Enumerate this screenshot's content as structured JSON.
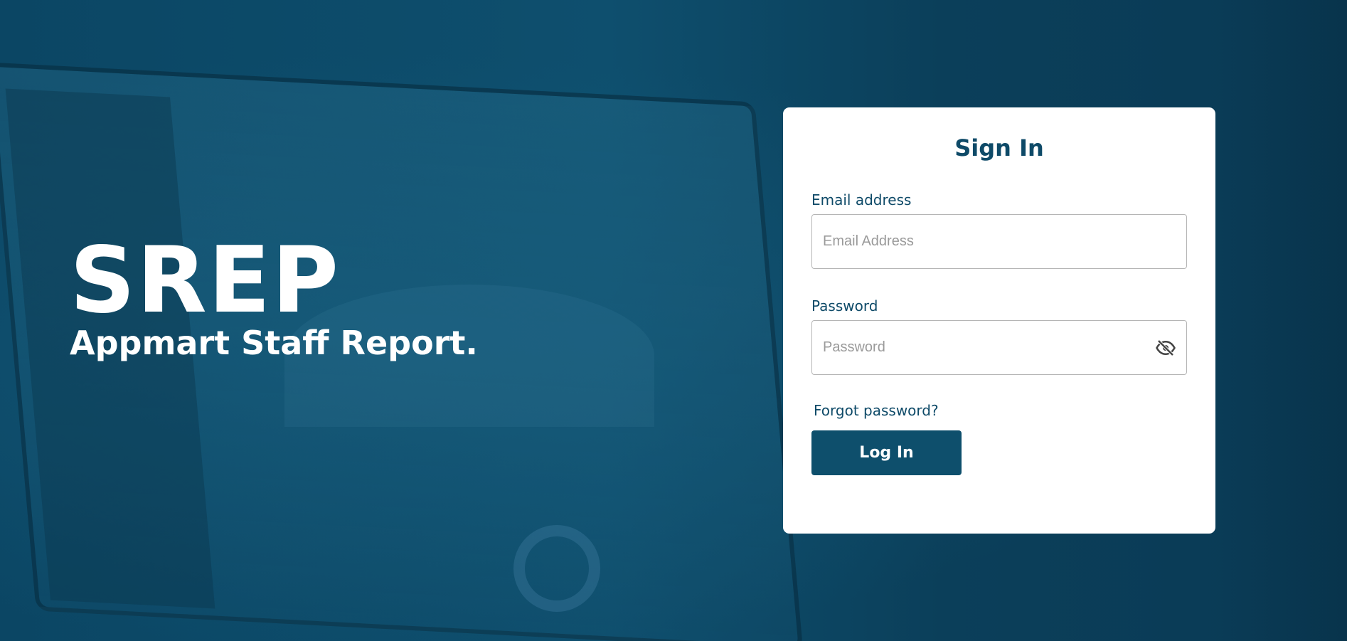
{
  "brand": {
    "title": "SREP",
    "subtitle": "Appmart Staff Report."
  },
  "signin": {
    "heading": "Sign In",
    "email_label": "Email address",
    "email_placeholder": "Email Address",
    "email_value": "",
    "password_label": "Password",
    "password_placeholder": "Password",
    "password_value": "",
    "password_toggle_icon": "eye-off-icon",
    "forgot_label": "Forgot password?",
    "login_label": "Log In"
  },
  "colors": {
    "primary": "#0e4f6c",
    "heading": "#0e4a68",
    "background_overlay": "#0c4560",
    "card": "#ffffff"
  }
}
